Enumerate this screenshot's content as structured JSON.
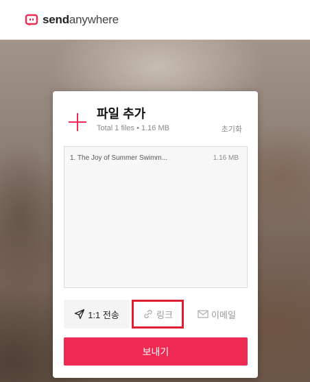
{
  "header": {
    "logo_bold": "send",
    "logo_light": "anywhere",
    "brand_color": "#ee2a52"
  },
  "card": {
    "title": "파일 추가",
    "summary": "Total 1 files • 1.16 MB",
    "reset_label": "초기화",
    "add_icon": "plus-icon",
    "files": [
      {
        "name": "1. The Joy of Summer Swimm...",
        "size": "1.16 MB"
      }
    ],
    "tabs": [
      {
        "label": "1:1 전송",
        "icon": "paper-plane-icon",
        "active": true
      },
      {
        "label": "링크",
        "icon": "link-icon",
        "highlighted": true
      },
      {
        "label": "이메일",
        "icon": "mail-icon"
      }
    ],
    "send_label": "보내기",
    "accent_color": "#ee2a52",
    "highlight_color": "#e01e32"
  }
}
